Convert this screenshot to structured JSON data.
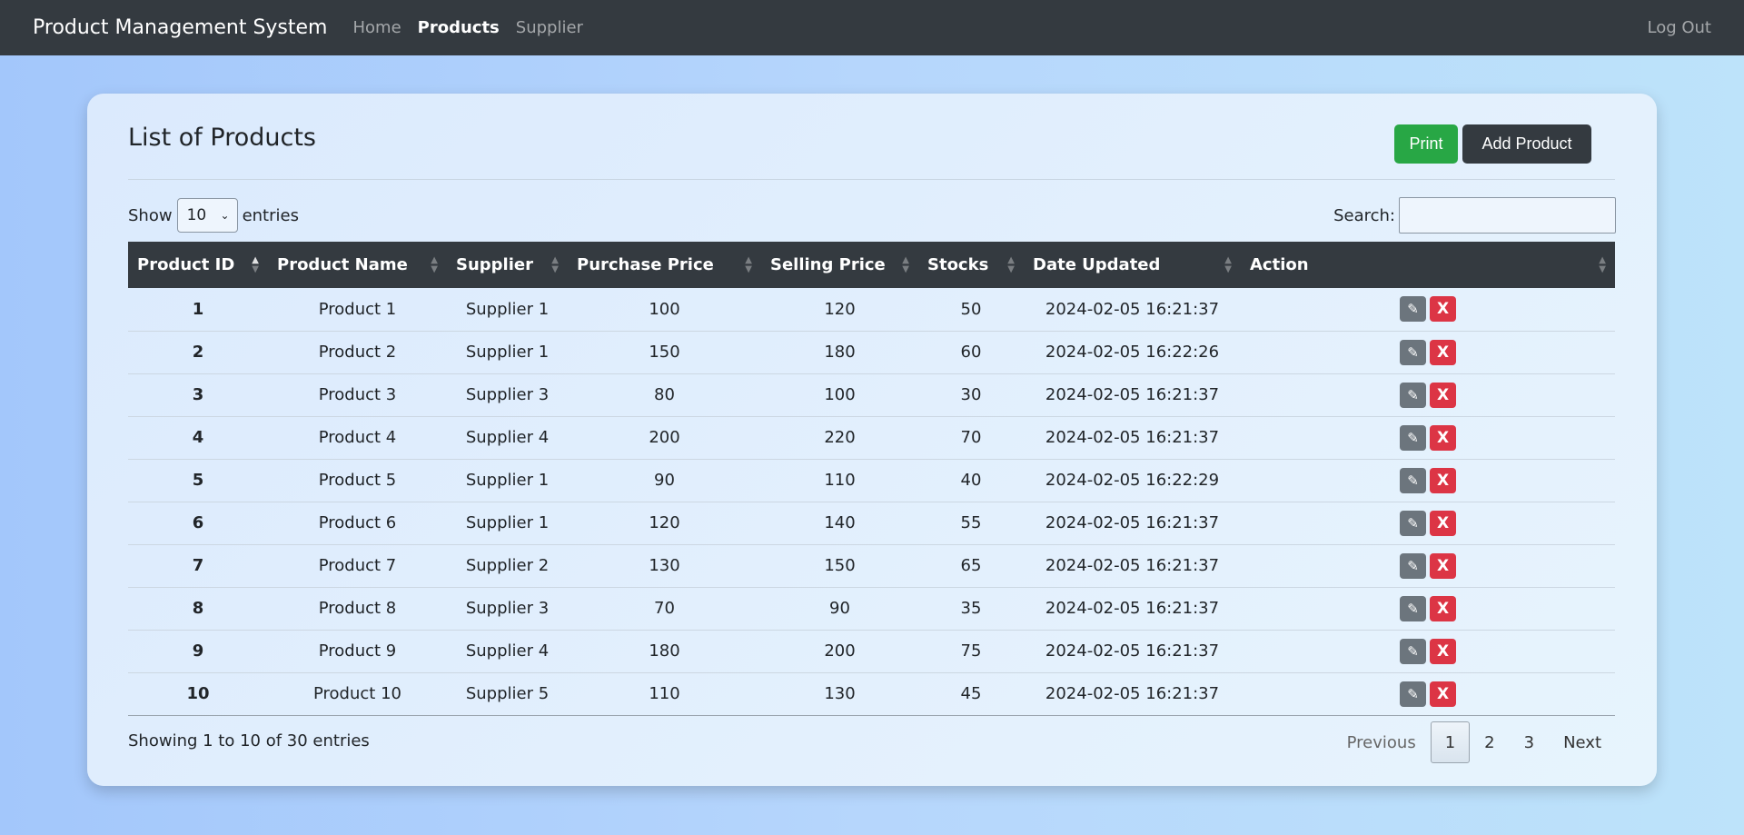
{
  "nav": {
    "brand": "Product Management System",
    "links": [
      {
        "label": "Home",
        "active": false
      },
      {
        "label": "Products",
        "active": true
      },
      {
        "label": "Supplier",
        "active": false
      }
    ],
    "logout": "Log Out"
  },
  "page": {
    "title": "List of Products",
    "print_label": "Print",
    "add_label": "Add Product",
    "show_label": "Show",
    "entries_value": "10",
    "entries_label": "entries",
    "search_label": "Search:",
    "search_value": ""
  },
  "table": {
    "columns": [
      "Product ID",
      "Product Name",
      "Supplier",
      "Purchase Price",
      "Selling Price",
      "Stocks",
      "Date Updated",
      "Action"
    ],
    "rows": [
      [
        "1",
        "Product 1",
        "Supplier 1",
        "100",
        "120",
        "50",
        "2024-02-05 16:21:37"
      ],
      [
        "2",
        "Product 2",
        "Supplier 1",
        "150",
        "180",
        "60",
        "2024-02-05 16:22:26"
      ],
      [
        "3",
        "Product 3",
        "Supplier 3",
        "80",
        "100",
        "30",
        "2024-02-05 16:21:37"
      ],
      [
        "4",
        "Product 4",
        "Supplier 4",
        "200",
        "220",
        "70",
        "2024-02-05 16:21:37"
      ],
      [
        "5",
        "Product 5",
        "Supplier 1",
        "90",
        "110",
        "40",
        "2024-02-05 16:22:29"
      ],
      [
        "6",
        "Product 6",
        "Supplier 1",
        "120",
        "140",
        "55",
        "2024-02-05 16:21:37"
      ],
      [
        "7",
        "Product 7",
        "Supplier 2",
        "130",
        "150",
        "65",
        "2024-02-05 16:21:37"
      ],
      [
        "8",
        "Product 8",
        "Supplier 3",
        "70",
        "90",
        "35",
        "2024-02-05 16:21:37"
      ],
      [
        "9",
        "Product 9",
        "Supplier 4",
        "180",
        "200",
        "75",
        "2024-02-05 16:21:37"
      ],
      [
        "10",
        "Product 10",
        "Supplier 5",
        "110",
        "130",
        "45",
        "2024-02-05 16:21:37"
      ]
    ],
    "edit_icon": "pencil-icon",
    "delete_label": "X"
  },
  "footer": {
    "info": "Showing 1 to 10 of 30 entries",
    "previous": "Previous",
    "pages": [
      "1",
      "2",
      "3"
    ],
    "current_page": "1",
    "next": "Next"
  },
  "colors": {
    "navbar": "#343a40",
    "print": "#28a745",
    "delete": "#dc3545",
    "edit": "#6c757d"
  }
}
